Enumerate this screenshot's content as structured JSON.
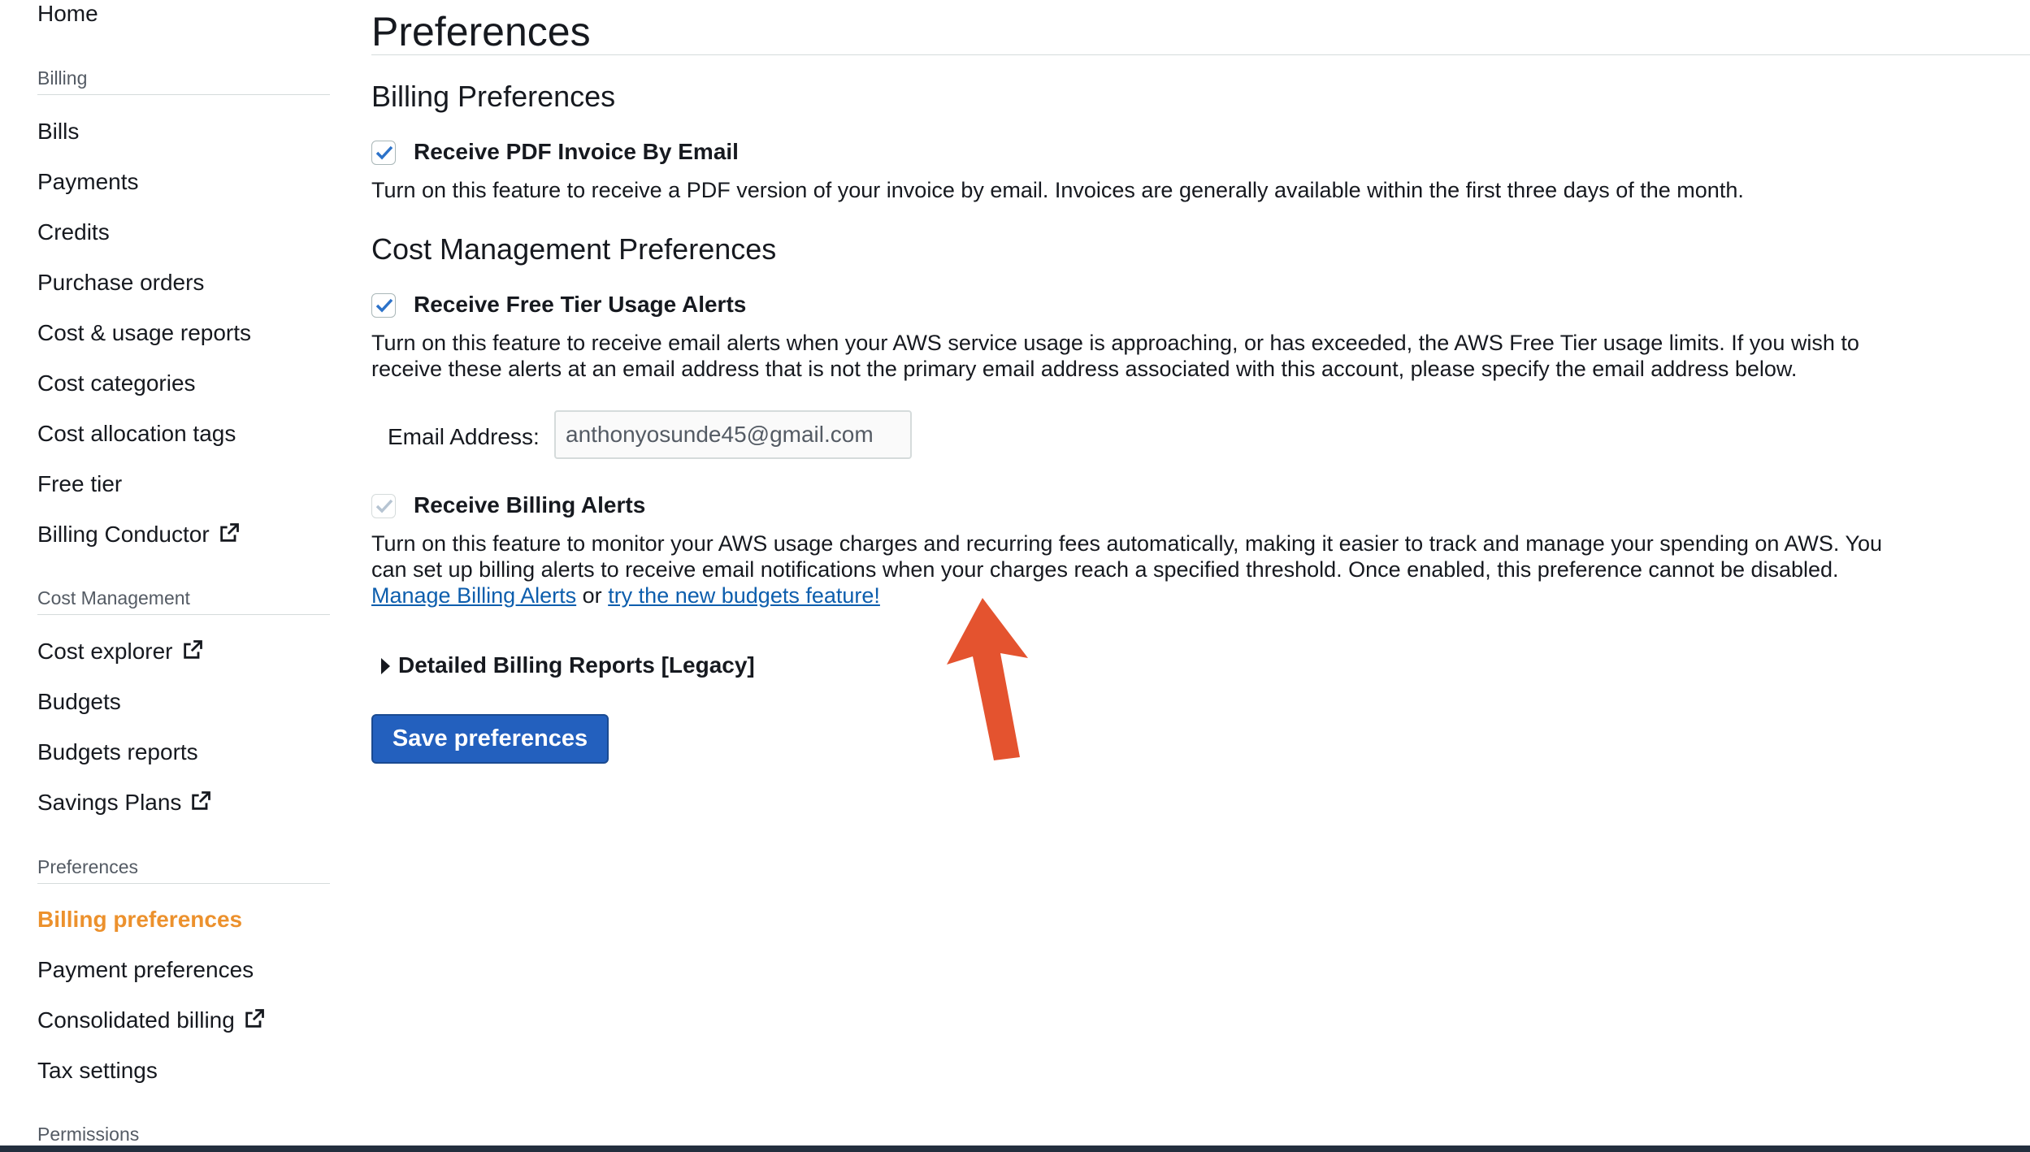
{
  "sidebar": {
    "home": "Home",
    "billing_section": "Billing",
    "billing_items": [
      "Bills",
      "Payments",
      "Credits",
      "Purchase orders",
      "Cost & usage reports",
      "Cost categories",
      "Cost allocation tags",
      "Free tier",
      "Billing Conductor"
    ],
    "cost_section": "Cost Management",
    "cost_items": [
      "Cost explorer",
      "Budgets",
      "Budgets reports",
      "Savings Plans"
    ],
    "prefs_section": "Preferences",
    "prefs_items": [
      "Billing preferences",
      "Payment preferences",
      "Consolidated billing",
      "Tax settings"
    ],
    "permissions_section": "Permissions",
    "active_item": "Billing preferences"
  },
  "main": {
    "title": "Preferences",
    "billing_prefs_heading": "Billing Preferences",
    "pdf_invoice": {
      "label": "Receive PDF Invoice By Email",
      "checked": true,
      "description": "Turn on this feature to receive a PDF version of your invoice by email. Invoices are generally available within the first three days of the month."
    },
    "cost_mgmt_heading": "Cost Management Preferences",
    "free_tier": {
      "label": "Receive Free Tier Usage Alerts",
      "checked": true,
      "description": "Turn on this feature to receive email alerts when your AWS service usage is approaching, or has exceeded, the AWS Free Tier usage limits. If you wish to receive these alerts at an email address that is not the primary email address associated with this account, please specify the email address below.",
      "email_label": "Email Address:",
      "email_value": "anthonyosunde45@gmail.com"
    },
    "billing_alerts": {
      "label": "Receive Billing Alerts",
      "checked": true,
      "disabled": true,
      "description": "Turn on this feature to monitor your AWS usage charges and recurring fees automatically, making it easier to track and manage your spending on AWS. You can set up billing alerts to receive email notifications when your charges reach a specified threshold. Once enabled, this preference cannot be disabled.",
      "manage_link": "Manage Billing Alerts",
      "or_text": "or",
      "budgets_link": "try the new budgets feature!"
    },
    "detailed_reports": "Detailed Billing Reports [Legacy]",
    "save_button": "Save preferences"
  },
  "colors": {
    "active_nav": "#ec912d",
    "primary_button": "#2360be",
    "link": "#0d5ead",
    "checkbox": "#2c72c9",
    "annotation_arrow": "#e4532f"
  },
  "icons": {
    "external_link": "external-link-icon",
    "checkmark": "checkmark-icon",
    "caret": "caret-right-icon",
    "annotation": "red-arrow-annotation"
  }
}
